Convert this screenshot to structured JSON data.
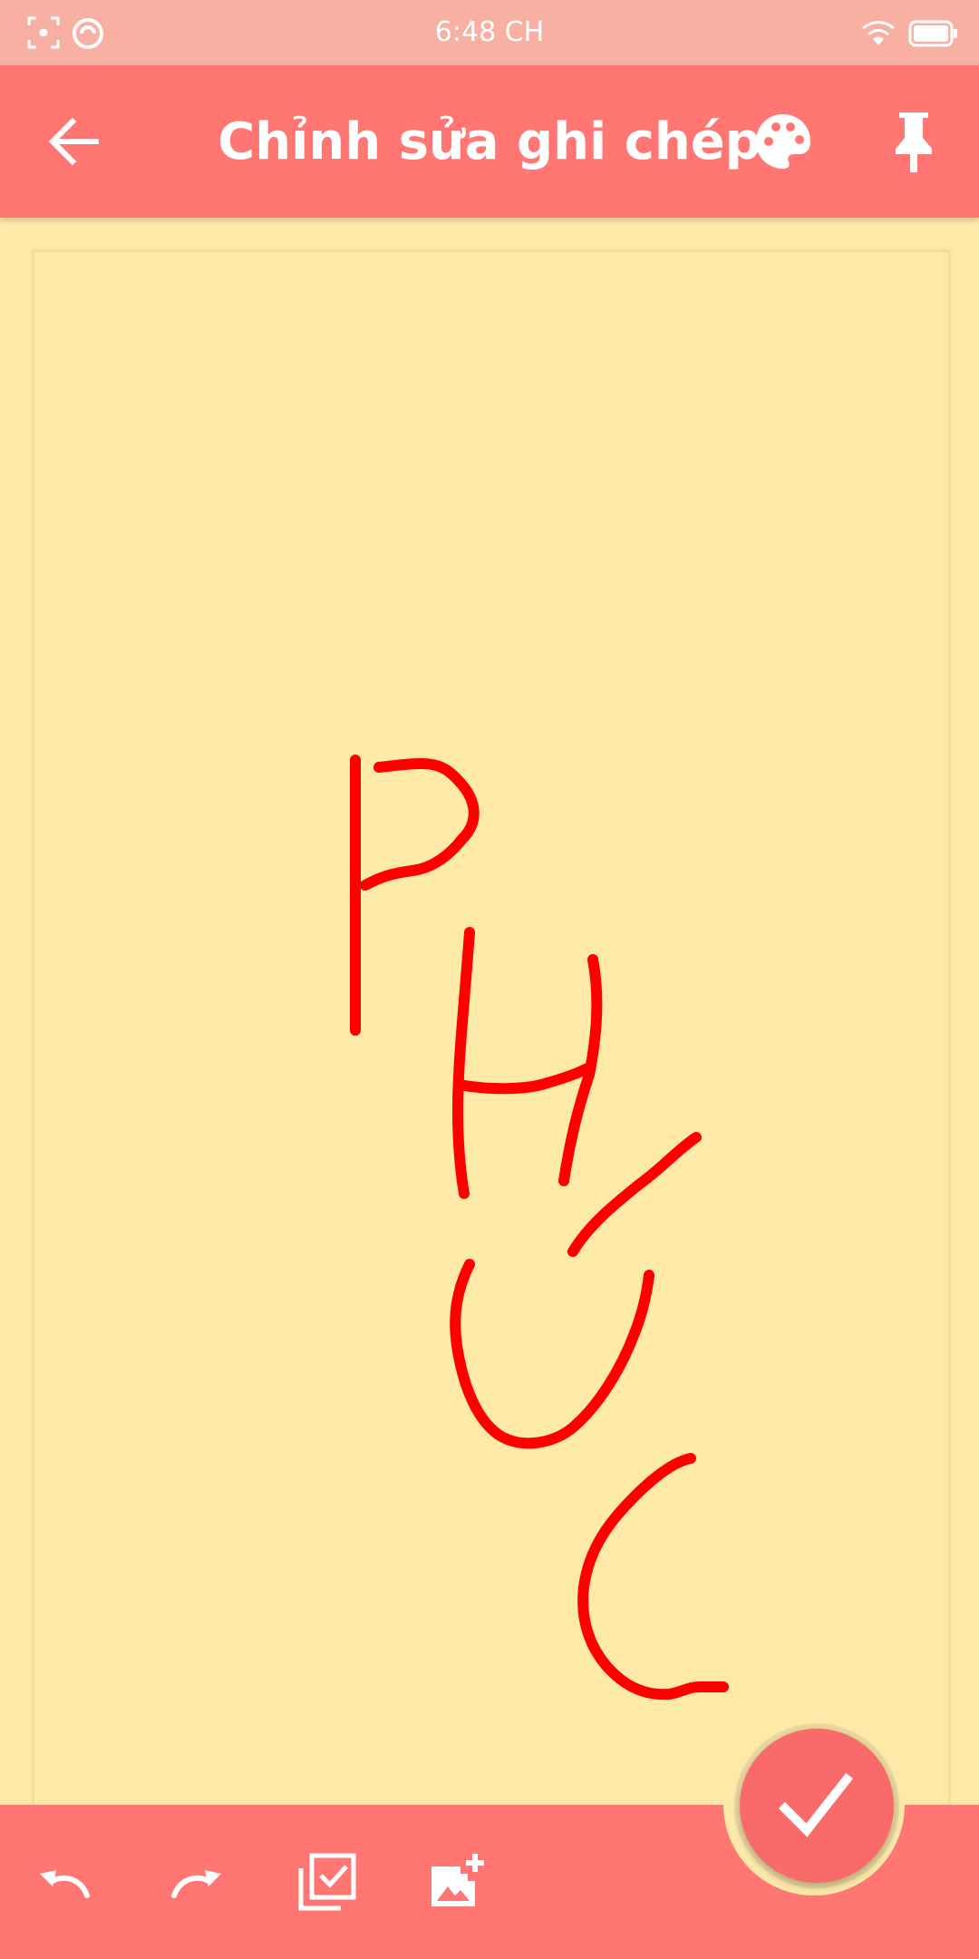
{
  "status_bar": {
    "time": "6:48 CH",
    "icons": [
      "screenshot-icon",
      "sync-icon",
      "wifi-icon",
      "battery-icon"
    ]
  },
  "app_bar": {
    "title": "Chỉnh sửa ghi chép",
    "icons": [
      "back-arrow-icon",
      "palette-icon",
      "pin-icon"
    ]
  },
  "note": {
    "background": "#FDEAA8",
    "drawing_color": "#FF0000"
  },
  "bottom_bar": {
    "icons": [
      "undo-icon",
      "redo-icon",
      "checklist-icon",
      "add-image-icon"
    ],
    "fab_icon": "check-icon"
  },
  "colors": {
    "accent": "#FF7673",
    "status_bar": "#F8B0A2",
    "fab": "#F96B6A"
  }
}
